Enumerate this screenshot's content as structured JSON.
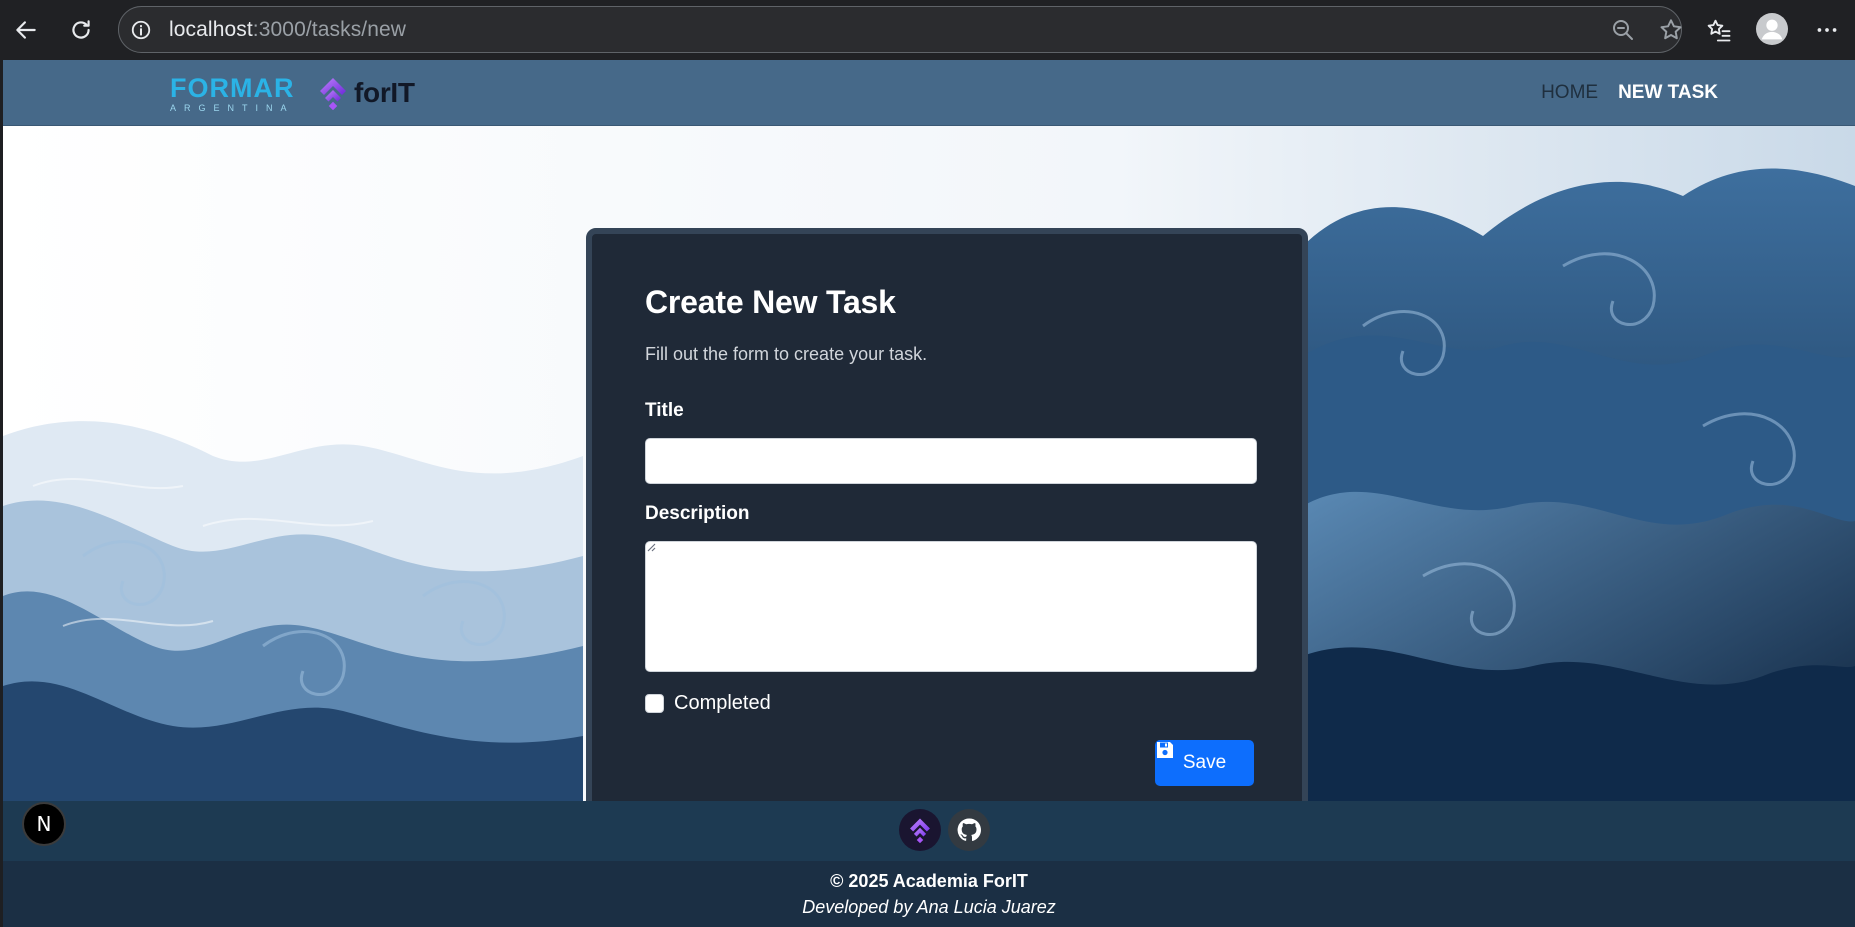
{
  "browser": {
    "url_host": "localhost",
    "url_path": ":3000/tasks/new",
    "icons": [
      "back-icon",
      "reload-icon",
      "site-info-icon",
      "zoom-out-icon",
      "favorite-star-icon",
      "favorites-icon",
      "profile-icon",
      "more-icon"
    ]
  },
  "navbar": {
    "logo_formar": "FORMAR",
    "logo_formar_sub": "ARGENTINA",
    "logo_forit": "forIT",
    "links": [
      {
        "label": "HOME",
        "active": false
      },
      {
        "label": "NEW TASK",
        "active": true
      }
    ]
  },
  "form": {
    "title": "Create New Task",
    "subtitle": "Fill out the form to create your task.",
    "title_label": "Title",
    "title_value": "",
    "description_label": "Description",
    "description_value": "",
    "completed_label": "Completed",
    "completed": false,
    "save_label": "Save"
  },
  "footer": {
    "copyright": "© 2025 Academia ForIT",
    "developer": "Developed by Ana Lucia Juarez",
    "social_icons": [
      "forit-icon",
      "github-icon"
    ]
  },
  "next_badge": "N",
  "colors": {
    "navbar": "#466989",
    "card": "#1f2937",
    "primary": "#0d6efd",
    "footer_top": "#1d3a52",
    "footer_bottom": "#1b2f44"
  }
}
